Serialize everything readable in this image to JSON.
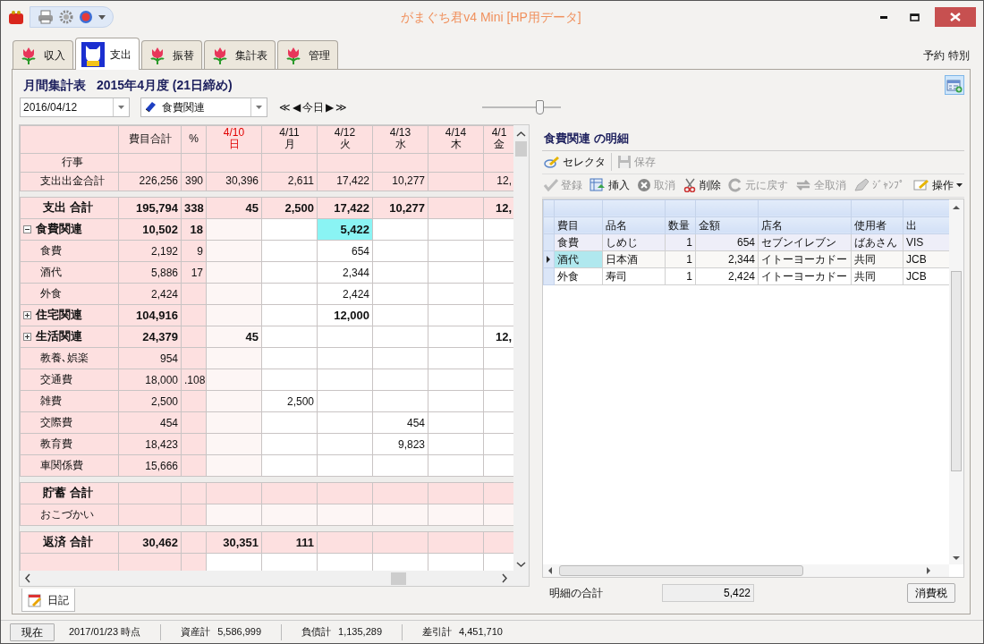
{
  "window": {
    "title": "がまぐち君v4 Mini  [HP用データ]"
  },
  "tabs": [
    {
      "label": "収入",
      "kind": "tulip",
      "selected": false
    },
    {
      "label": "支出",
      "kind": "cat",
      "selected": true
    },
    {
      "label": "振替",
      "kind": "tulip",
      "selected": false
    },
    {
      "label": "集計表",
      "kind": "tulip",
      "selected": false
    },
    {
      "label": "管理",
      "kind": "tulip",
      "selected": false
    }
  ],
  "top_links": [
    "予約",
    "特別"
  ],
  "heading": {
    "title": "月間集計表",
    "period": "2015年4月度 (21日締め)"
  },
  "date_field": {
    "value": "2016/04/12"
  },
  "category_field": {
    "value": "食費関連"
  },
  "nav": [
    "≪",
    "◀",
    "今日",
    "▶",
    "≫"
  ],
  "zoom_slider": {
    "level": 0.73
  },
  "summary_table": {
    "headers": [
      "費目合計",
      "%"
    ],
    "days": [
      {
        "date": "4/10",
        "weekday": "日",
        "kind": "sunday",
        "selected": false
      },
      {
        "date": "4/11",
        "weekday": "月",
        "kind": "weekday",
        "selected": false
      },
      {
        "date": "4/12",
        "weekday": "火",
        "kind": "weekday",
        "selected": true
      },
      {
        "date": "4/13",
        "weekday": "水",
        "kind": "weekday",
        "selected": false
      },
      {
        "date": "4/14",
        "weekday": "木",
        "kind": "weekday",
        "selected": false
      },
      {
        "date": "4/1",
        "weekday": "金",
        "kind": "weekday",
        "selected": false
      }
    ],
    "sections": [
      {
        "rows": [
          {
            "kind": "event",
            "label": "行事",
            "values": {},
            "selected": false
          },
          {
            "kind": "sum",
            "label": "支出出金合計",
            "values": {
              "total": "226,256",
              "percent": "390",
              "day_1": "30,396",
              "day_2": "2,611",
              "day_3": "17,422",
              "day_4": "10,277",
              "day_6": "12,"
            },
            "selected": false
          }
        ]
      },
      {
        "rows": [
          {
            "kind": "total",
            "label": "支出 合計",
            "values": {
              "total": "195,794",
              "percent": "338",
              "day_1": "45",
              "day_2": "2,500",
              "day_3": "17,422",
              "day_4": "10,277",
              "day_6": "12,"
            },
            "selected": false
          },
          {
            "kind": "group",
            "label": "食費関連",
            "expanded": true,
            "values": {
              "total": "10,502",
              "percent": "18",
              "day_3": "5,422"
            },
            "selected": true
          },
          {
            "kind": "item",
            "label": "食費",
            "values": {
              "total": "2,192",
              "percent": "9",
              "day_3": "654"
            },
            "selected": false
          },
          {
            "kind": "item",
            "label": "酒代",
            "values": {
              "total": "5,886",
              "percent": "17",
              "day_3": "2,344"
            },
            "selected": false
          },
          {
            "kind": "item",
            "label": "外食",
            "values": {
              "total": "2,424",
              "day_3": "2,424"
            },
            "selected": false
          },
          {
            "kind": "group",
            "label": "住宅関連",
            "expanded": false,
            "values": {
              "total": "104,916",
              "day_3": "12,000"
            },
            "selected": false
          },
          {
            "kind": "group",
            "label": "生活関連",
            "expanded": false,
            "values": {
              "total": "24,379",
              "day_1": "45",
              "day_6": "12,"
            },
            "selected": false
          },
          {
            "kind": "item",
            "label": "教養､娯楽",
            "values": {
              "total": "954"
            },
            "selected": false
          },
          {
            "kind": "item",
            "label": "交通費",
            "values": {
              "total": "18,000",
              "percent": ".108"
            },
            "selected": false
          },
          {
            "kind": "item",
            "label": "雑費",
            "values": {
              "total": "2,500",
              "day_2": "2,500"
            },
            "selected": false
          },
          {
            "kind": "item",
            "label": "交際費",
            "values": {
              "total": "454",
              "day_4": "454"
            },
            "selected": false
          },
          {
            "kind": "item",
            "label": "教育費",
            "values": {
              "total": "18,423",
              "day_4": "9,823"
            },
            "selected": false
          },
          {
            "kind": "item",
            "label": "車関係費",
            "values": {
              "total": "15,666"
            },
            "selected": false
          }
        ]
      },
      {
        "rows": [
          {
            "kind": "total",
            "label": "貯蓄 合計",
            "values": {},
            "selected": false
          },
          {
            "kind": "item",
            "label": "おこづかい",
            "values": {},
            "selected": false
          }
        ]
      },
      {
        "rows": [
          {
            "kind": "total",
            "label": "返済 合計",
            "values": {
              "total": "30,462",
              "day_1": "30,351",
              "day_2": "111"
            },
            "selected": false
          }
        ]
      }
    ]
  },
  "bottom_tab": {
    "label": "日記"
  },
  "detail": {
    "title": "食費関連 の明細",
    "toolbar_1": [
      {
        "label": "セレクタ",
        "kind": "selector",
        "disabled": false
      },
      {
        "label": "保存",
        "kind": "save",
        "disabled": true
      }
    ],
    "toolbar_2": [
      {
        "label": "登録",
        "kind": "register",
        "disabled": true
      },
      {
        "label": "挿入",
        "kind": "insert",
        "disabled": false
      },
      {
        "label": "取消",
        "kind": "cancel",
        "disabled": true
      },
      {
        "label": "削除",
        "kind": "delete",
        "disabled": false
      },
      {
        "label": "元に戻す",
        "kind": "undo",
        "disabled": true
      },
      {
        "label": "全取消",
        "kind": "clear",
        "disabled": true
      },
      {
        "label": "ｼﾞｬﾝﾌﾟ",
        "kind": "jump",
        "disabled": true
      }
    ],
    "menu_button": {
      "label": "操作"
    },
    "grid": {
      "columns": [
        "費目",
        "品名",
        "数量",
        "金額",
        "店名",
        "使用者",
        "出"
      ],
      "rows": [
        {
          "cells": [
            "食費",
            "しめじ",
            "1",
            "654",
            "セブンイレブン",
            "ばあさん",
            "VIS"
          ],
          "selected": false
        },
        {
          "cells": [
            "酒代",
            "日本酒",
            "1",
            "2,344",
            "イトーヨーカドー",
            "共同",
            "JCB"
          ],
          "selected": true
        },
        {
          "cells": [
            "外食",
            "寿司",
            "1",
            "2,424",
            "イトーヨーカドー",
            "共同",
            "JCB"
          ],
          "selected": false
        }
      ]
    },
    "total_label": "明細の合計",
    "total_value": "5,422",
    "tax_button": "消費税"
  },
  "status_bar": {
    "button": "現在",
    "as_of": "2017/01/23 時点",
    "items": [
      {
        "label": "資産計",
        "value": "5,586,999"
      },
      {
        "label": "負債計",
        "value": "1,135,289"
      },
      {
        "label": "差引計",
        "value": "4,451,710"
      }
    ]
  }
}
